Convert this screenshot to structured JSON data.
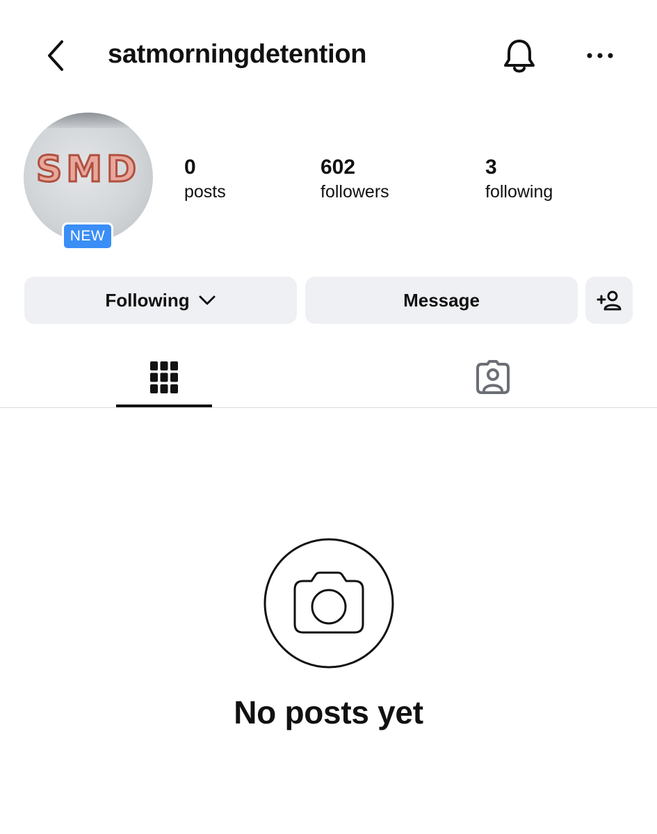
{
  "header": {
    "username": "satmorningdetention",
    "icons": [
      "back-arrow-icon",
      "bell-icon",
      "more-horizontal-icon"
    ]
  },
  "profile": {
    "avatar_text": "SMD",
    "badge": "NEW",
    "stats": [
      {
        "value": "0",
        "label": "posts"
      },
      {
        "value": "602",
        "label": "followers"
      },
      {
        "value": "3",
        "label": "following"
      }
    ]
  },
  "actions": {
    "following_label": "Following",
    "message_label": "Message",
    "icons": [
      "chevron-down-icon",
      "add-user-icon"
    ]
  },
  "tabs": [
    {
      "name": "posts-grid",
      "icon": "grid-icon",
      "active": true
    },
    {
      "name": "tagged",
      "icon": "tagged-person-icon",
      "active": false
    }
  ],
  "empty_state": {
    "icon": "camera-icon",
    "title": "No posts yet"
  },
  "colors": {
    "badge": "#3a8ef6",
    "button_bg": "#eff0f3",
    "text": "#111111",
    "muted_icon": "#6b6f75"
  }
}
